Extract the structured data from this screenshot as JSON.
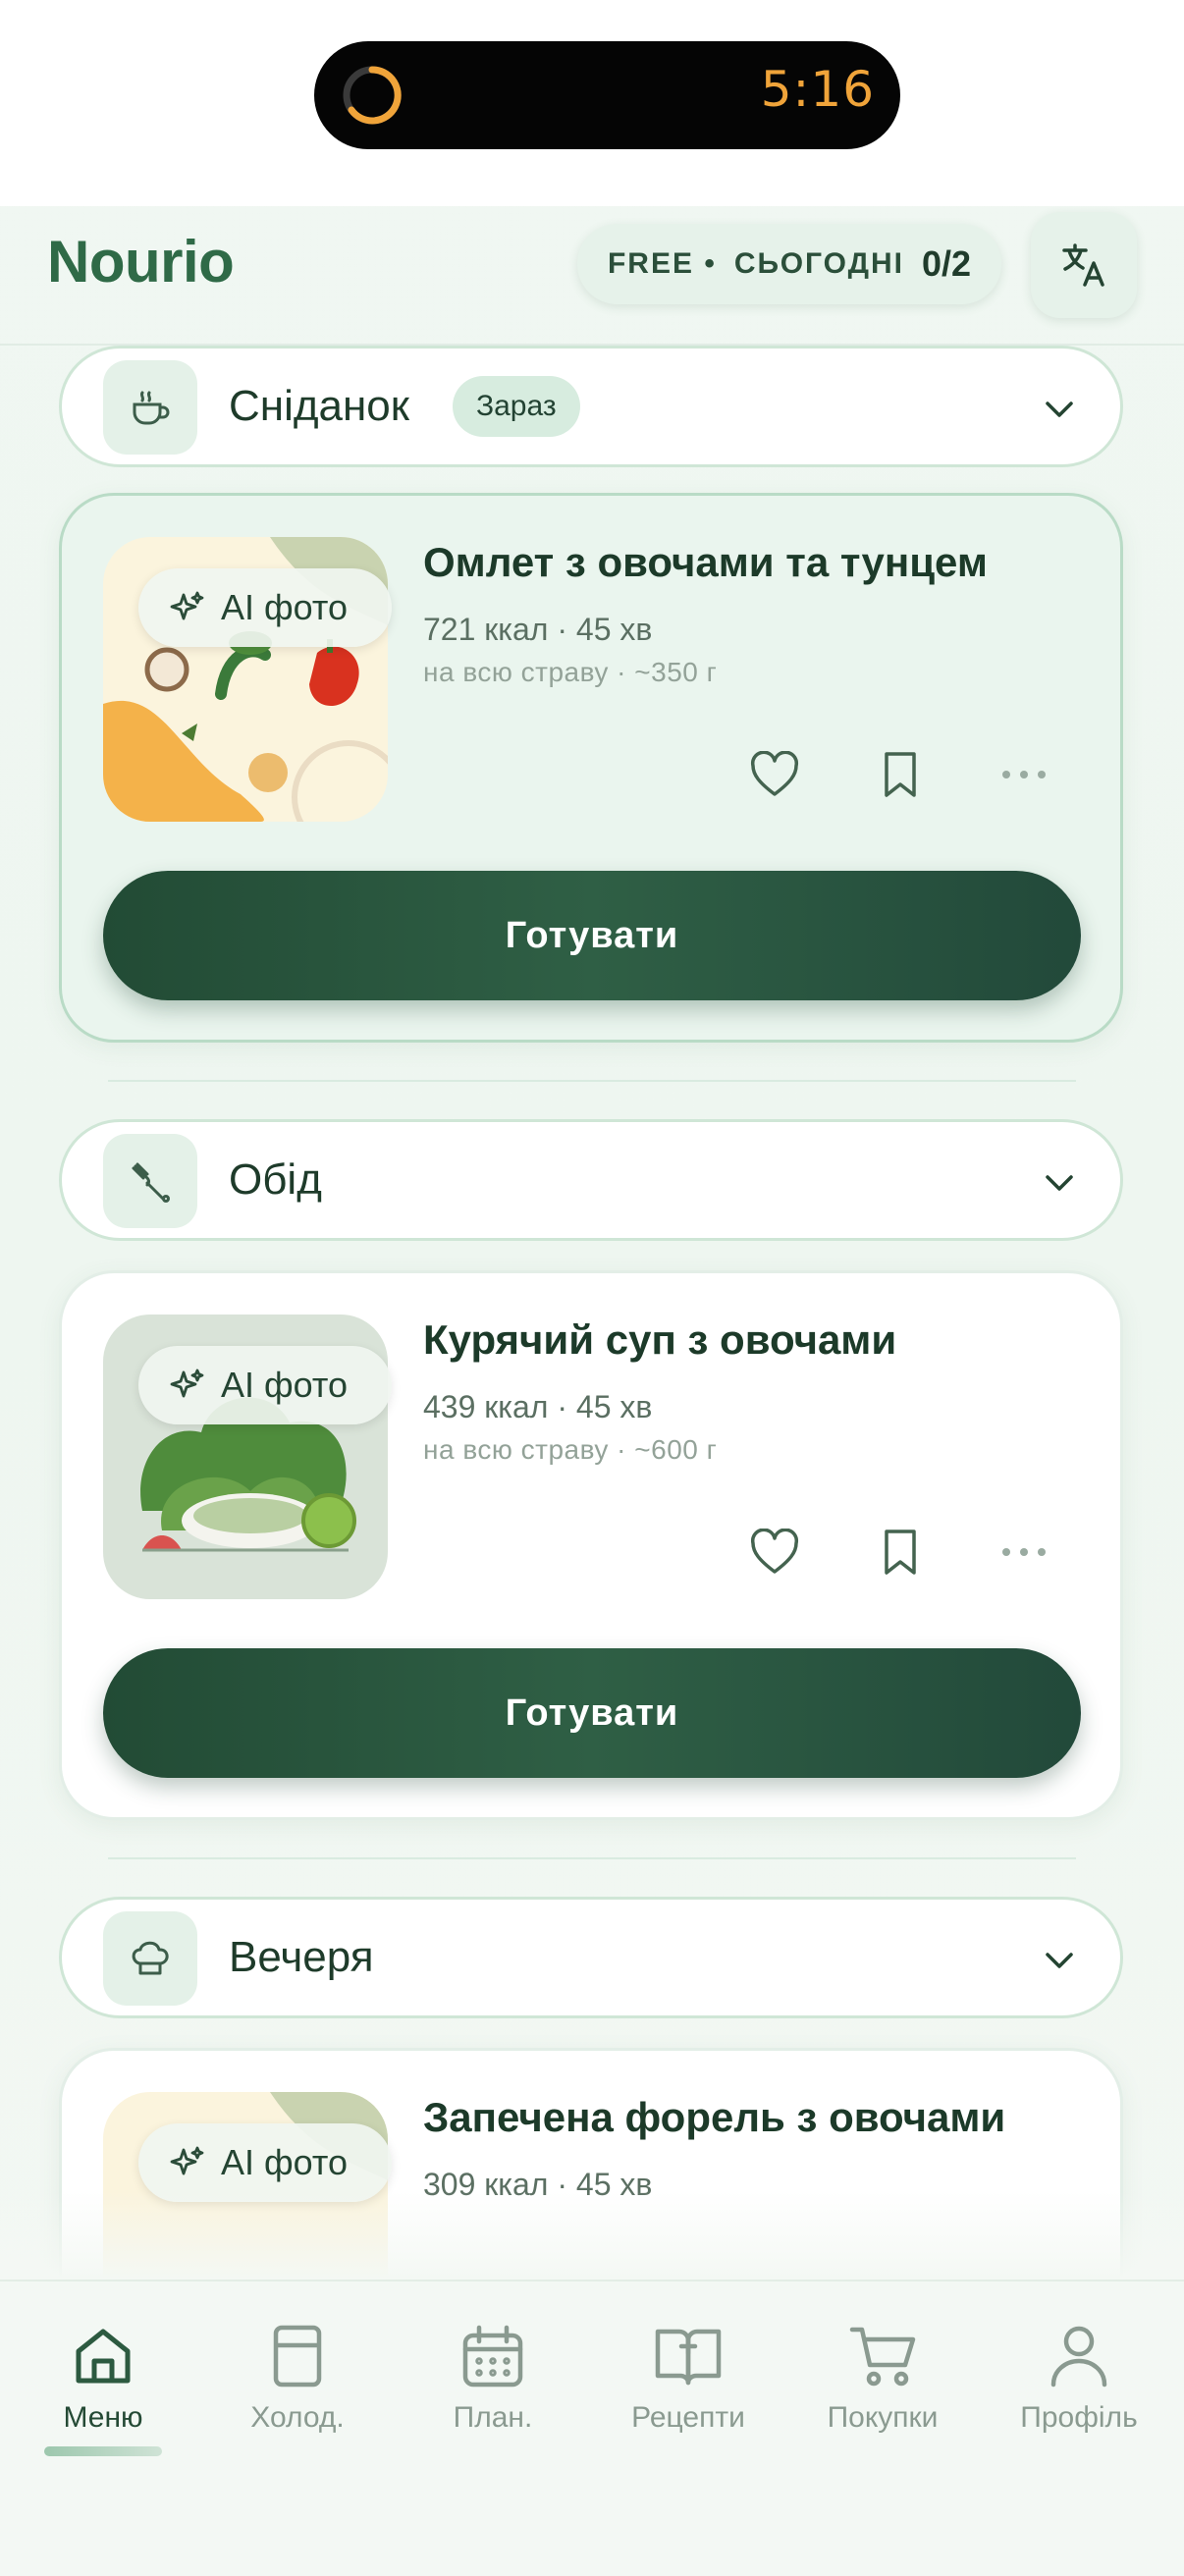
{
  "status": {
    "time": "5:16"
  },
  "header": {
    "app_name": "Nourio",
    "plan_label": "FREE",
    "plan_dot": "•",
    "today_label": "СЬОГОДНІ",
    "today_count": "0/2",
    "translate_icon": "translate-icon"
  },
  "meals": [
    {
      "name": "Сніданок",
      "badge": "Зараз",
      "icon": "coffee-cup-icon",
      "recipe": {
        "badge": "AI фото",
        "title": "Омлет з овочами та тунцем",
        "meta": "721 ккал · 45 хв",
        "sub": "на всю страву · ~350 г",
        "cta": "Готувати"
      }
    },
    {
      "name": "Обід",
      "icon": "utensils-icon",
      "recipe": {
        "badge": "AI фото",
        "title": "Курячий суп з овочами",
        "meta": "439 ккал · 45 хв",
        "sub": "на всю страву · ~600 г",
        "cta": "Готувати"
      }
    },
    {
      "name": "Вечеря",
      "icon": "chef-hat-icon",
      "recipe": {
        "badge": "AI фото",
        "title": "Запечена форель з овочами",
        "meta": "309 ккал · 45 хв"
      }
    }
  ],
  "tabs": [
    {
      "label": "Меню",
      "icon": "home-icon",
      "active": true
    },
    {
      "label": "Холод.",
      "icon": "fridge-icon"
    },
    {
      "label": "План.",
      "icon": "calendar-icon"
    },
    {
      "label": "Рецепти",
      "icon": "recipe-book-icon"
    },
    {
      "label": "Покупки",
      "icon": "cart-icon"
    },
    {
      "label": "Профіль",
      "icon": "profile-icon"
    }
  ],
  "colors": {
    "brand": "#2f6a47",
    "primary_button": "#244e38",
    "accent_time": "#f0a43a"
  }
}
